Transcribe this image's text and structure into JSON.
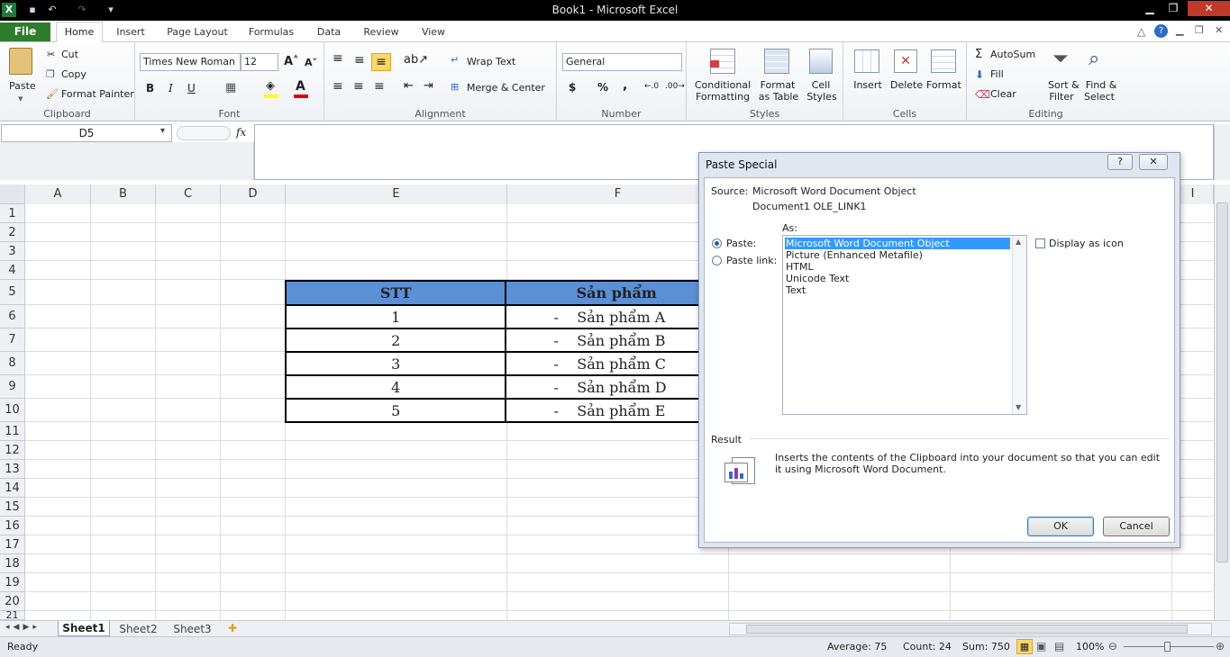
{
  "window": {
    "title": "Book1 - Microsoft Excel"
  },
  "ribbon_tabs": {
    "file": "File",
    "home": "Home",
    "items": [
      "Insert",
      "Page Layout",
      "Formulas",
      "Data",
      "Review",
      "View"
    ]
  },
  "clipboard": {
    "paste": "Paste",
    "cut": "Cut",
    "copy": "Copy",
    "format_painter": "Format Painter",
    "label": "Clipboard"
  },
  "font": {
    "name": "Times New Roman",
    "size": "12",
    "label": "Font",
    "bold": "B",
    "italic": "I",
    "underline": "U"
  },
  "alignment": {
    "wrap": "Wrap Text",
    "merge": "Merge & Center",
    "label": "Alignment"
  },
  "number": {
    "format": "General",
    "label": "Number",
    "currency": "$",
    "percent": "%",
    "comma": ","
  },
  "styles": {
    "conditional": [
      "Conditional",
      "Formatting"
    ],
    "format_table": [
      "Format",
      "as Table"
    ],
    "cell_styles": [
      "Cell",
      "Styles"
    ],
    "label": "Styles"
  },
  "cells": {
    "insert": "Insert",
    "delete": "Delete",
    "format": "Format",
    "label": "Cells"
  },
  "editing": {
    "autosum": "AutoSum",
    "fill": "Fill",
    "clear": "Clear",
    "sort": [
      "Sort &",
      "Filter"
    ],
    "find": [
      "Find &",
      "Select"
    ],
    "label": "Editing"
  },
  "formula_bar": {
    "name_box": "D5",
    "fx": "fx",
    "value": ""
  },
  "columns": [
    "A",
    "B",
    "C",
    "D",
    "E",
    "F",
    "I"
  ],
  "rows": [
    "1",
    "2",
    "3",
    "4",
    "5",
    "6",
    "7",
    "8",
    "9",
    "10",
    "11",
    "12",
    "13",
    "14",
    "15",
    "16",
    "17",
    "18",
    "19",
    "20",
    "21"
  ],
  "table": {
    "headers": [
      "STT",
      "Sản phẩm"
    ],
    "rows": [
      [
        "1",
        "-    Sản phẩm A"
      ],
      [
        "2",
        "-    Sản phẩm B"
      ],
      [
        "3",
        "-    Sản phẩm C"
      ],
      [
        "4",
        "-    Sản phẩm D"
      ],
      [
        "5",
        "-    Sản phẩm E"
      ]
    ]
  },
  "dialog": {
    "title": "Paste Special",
    "help": "?",
    "close": "✕",
    "source_label": "Source:",
    "source_value": "Microsoft Word Document Object",
    "source_doc": "Document1 OLE_LINK1",
    "as_label": "As:",
    "paste_label": "Paste:",
    "paste_link_label": "Paste link:",
    "options": [
      "Microsoft Word Document Object",
      "Picture (Enhanced Metafile)",
      "HTML",
      "Unicode Text",
      "Text"
    ],
    "display_icon": "Display as icon",
    "result_label": "Result",
    "result_text": "Inserts the contents of the Clipboard into your document so that you can edit it using Microsoft Word Document.",
    "ok": "OK",
    "cancel": "Cancel"
  },
  "sheets": [
    "Sheet1",
    "Sheet2",
    "Sheet3"
  ],
  "status": {
    "ready": "Ready",
    "average": "Average: 75",
    "count": "Count: 24",
    "sum": "Sum: 750",
    "zoom": "100%"
  }
}
